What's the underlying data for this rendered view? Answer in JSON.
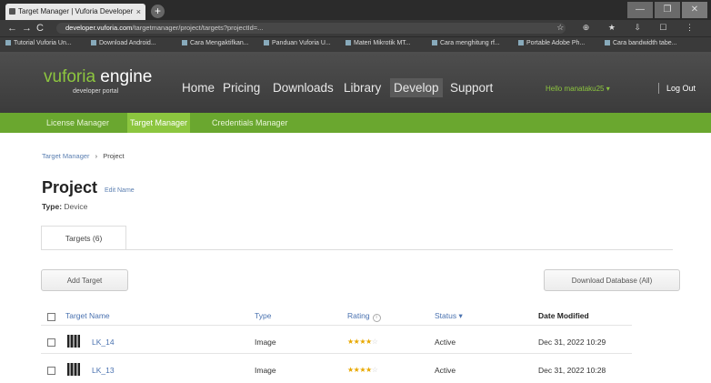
{
  "browser": {
    "tab_title": "Target Manager | Vuforia Developer",
    "tab_close": "×",
    "new_tab": "+",
    "window_controls": [
      "—",
      "❐",
      "✕"
    ],
    "back": "←",
    "forward": "→",
    "reload": "C",
    "url_host": "developer.vuforia.com",
    "url_path": "/targetmanager/project/targets?projectId=...",
    "toolbar_icons": "☆ ⊕ ★ ⇩ ☐ ⋮",
    "bookmarks": [
      "Tutorial Vuforia Un...",
      "Download Android...",
      "Cara Mengaktifkan...",
      "Panduan Vuforia U...",
      "Materi Mikrotik MT...",
      "Cara menghitung rf...",
      "Portable Adobe Ph...",
      "Cara bandwidth tabe..."
    ]
  },
  "header": {
    "logo_vuforia": "vuforia",
    "logo_engine": " engine",
    "logo_sub": "developer portal",
    "nav": [
      "Home",
      "Pricing",
      "Downloads",
      "Library",
      "Develop",
      "Support"
    ],
    "active_nav": "Develop",
    "user": "Hello manataku25 ▾",
    "logout": "Log Out"
  },
  "subnav": {
    "items": [
      "License Manager",
      "Target Manager",
      "Credentials Manager"
    ],
    "active": "Target Manager"
  },
  "breadcrumb": {
    "root": "Target Manager",
    "separator": "›",
    "current": "Project"
  },
  "project": {
    "title": "Project",
    "edit_name": "Edit Name",
    "type_label": "Type:",
    "type_value": "Device"
  },
  "tabs": {
    "targets": "Targets (6)"
  },
  "buttons": {
    "add_target": "Add Target",
    "download_database": "Download Database (All)"
  },
  "table": {
    "headers": {
      "name": "Target Name",
      "type": "Type",
      "rating": "Rating",
      "status": "Status ▾",
      "date": "Date Modified"
    },
    "rows": [
      {
        "name": "LK_14",
        "type": "Image",
        "rating": "★★★★",
        "rating_dim": "☆",
        "status": "Active",
        "date": "Dec 31, 2022 10:29"
      },
      {
        "name": "LK_13",
        "type": "Image",
        "rating": "★★★★",
        "rating_dim": "☆",
        "status": "Active",
        "date": "Dec 31, 2022 10:28"
      }
    ]
  },
  "colors": {
    "brand_green": "#8dc63f",
    "subnav_green": "#6aa72f",
    "header_dark": "#444444",
    "link_blue": "#4a72b0"
  }
}
